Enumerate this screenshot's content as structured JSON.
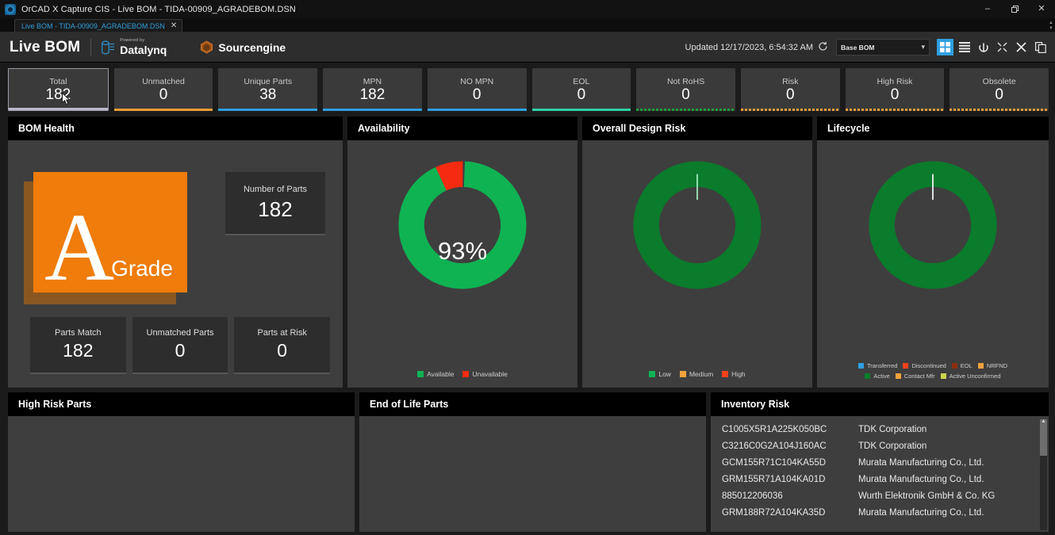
{
  "window": {
    "title": "OrCAD X Capture CIS - Live BOM - TIDA-00909_AGRADEBOM.DSN",
    "minimize_label": "–",
    "restore_label": "❐",
    "close_label": "✕",
    "app_icon": "orcad-app-icon"
  },
  "document_tab": {
    "label": "Live BOM - TIDA-00909_AGRADEBOM.DSN",
    "close_label": "✕"
  },
  "header": {
    "brand": "Live BOM",
    "partners": [
      {
        "pre": "Powered by",
        "name": "Datalynq",
        "tm": "™",
        "icon": "datalynq-logo"
      },
      {
        "pre": "",
        "name": "Sourcengine",
        "tm": "™",
        "icon": "sourcengine-logo"
      }
    ],
    "updated": "Updated 12/17/2023, 6:54:32 AM",
    "refresh_icon": "refresh-icon",
    "bom_select": {
      "value": "Base BOM",
      "caret": "▾"
    },
    "tool_icons": [
      {
        "name": "grid-view-icon",
        "glyph": "grid",
        "active": true
      },
      {
        "name": "list-view-icon",
        "glyph": "list",
        "active": false
      },
      {
        "name": "sync-icon",
        "glyph": "sync",
        "active": false
      },
      {
        "name": "collapse-icon",
        "glyph": "collapse",
        "active": false
      },
      {
        "name": "close-panel-icon",
        "glyph": "x",
        "active": false
      },
      {
        "name": "export-icon",
        "glyph": "export",
        "active": false
      }
    ]
  },
  "kpis": [
    {
      "label": "Total",
      "value": "182",
      "color": "#b9b9c9",
      "dotted": false,
      "selected": true
    },
    {
      "label": "Unmatched",
      "value": "0",
      "color": "#f29b38",
      "dotted": false,
      "selected": false
    },
    {
      "label": "Unique Parts",
      "value": "38",
      "color": "#2f9fe0",
      "dotted": false,
      "selected": false
    },
    {
      "label": "MPN",
      "value": "182",
      "color": "#2f9fe0",
      "dotted": false,
      "selected": false
    },
    {
      "label": "NO MPN",
      "value": "0",
      "color": "#2f9fe0",
      "dotted": false,
      "selected": false
    },
    {
      "label": "EOL",
      "value": "0",
      "color": "#2fd2a8",
      "dotted": false,
      "selected": false
    },
    {
      "label": "Not RoHS",
      "value": "0",
      "color": "#1e9e3e",
      "dotted": true,
      "selected": false
    },
    {
      "label": "Risk",
      "value": "0",
      "color": "#f29b38",
      "dotted": true,
      "selected": false
    },
    {
      "label": "High Risk",
      "value": "0",
      "color": "#f29b38",
      "dotted": true,
      "selected": false
    },
    {
      "label": "Obsolete",
      "value": "0",
      "color": "#f29b38",
      "dotted": true,
      "selected": false
    }
  ],
  "bom_health": {
    "title": "BOM Health",
    "grade_letter": "A",
    "grade_word": "Grade",
    "grade_color": "#ef7c0b",
    "number_of_parts": {
      "label": "Number of Parts",
      "value": "182"
    },
    "stats": [
      {
        "label": "Parts Match",
        "value": "182"
      },
      {
        "label": "Unmatched Parts",
        "value": "0"
      },
      {
        "label": "Parts at Risk",
        "value": "0"
      }
    ]
  },
  "availability": {
    "title": "Availability",
    "center_label": "93%",
    "chart_data": {
      "type": "pie",
      "title": "Availability",
      "categories": [
        "Available",
        "Unavailable"
      ],
      "values": [
        93,
        7
      ],
      "colors": [
        "#0fb352",
        "#f42b10"
      ],
      "legend_position": "bottom",
      "donut": true
    }
  },
  "design_risk": {
    "title": "Overall Design Risk",
    "chart_data": {
      "type": "pie",
      "title": "Overall Design Risk",
      "categories": [
        "Low",
        "Medium",
        "High"
      ],
      "values": [
        100,
        0,
        0
      ],
      "colors": [
        "#0a7c2b",
        "#f2a33c",
        "#f4421c"
      ],
      "legend_position": "bottom",
      "donut": true
    }
  },
  "lifecycle": {
    "title": "Lifecycle",
    "chart_data": {
      "type": "pie",
      "title": "Lifecycle",
      "categories": [
        "Transferred",
        "Discontinued",
        "EOL",
        "NRFND",
        "Active",
        "Contact Mfr",
        "Active Unconfirmed"
      ],
      "values": [
        0,
        0,
        0,
        0,
        100,
        0,
        0
      ],
      "colors": [
        "#2f9fe0",
        "#f4421c",
        "#8c2d10",
        "#f2a33c",
        "#0a7c2b",
        "#f2a33c",
        "#c9d44a"
      ],
      "legend_position": "bottom",
      "donut": true
    }
  },
  "high_risk_parts": {
    "title": "High Risk Parts",
    "rows": []
  },
  "end_of_life_parts": {
    "title": "End of Life Parts",
    "rows": []
  },
  "inventory_risk": {
    "title": "Inventory Risk",
    "rows": [
      {
        "mpn": "C1005X5R1A225K050BC",
        "mfr": "TDK Corporation"
      },
      {
        "mpn": "C3216C0G2A104J160AC",
        "mfr": "TDK Corporation"
      },
      {
        "mpn": "GCM155R71C104KA55D",
        "mfr": "Murata Manufacturing Co., Ltd."
      },
      {
        "mpn": "GRM155R71A104KA01D",
        "mfr": "Murata Manufacturing Co., Ltd."
      },
      {
        "mpn": "885012206036",
        "mfr": "Wurth Elektronik GmbH & Co. KG"
      },
      {
        "mpn": "GRM188R72A104KA35D",
        "mfr": "Murata Manufacturing Co., Ltd."
      }
    ],
    "scroll_up_arrow": "▲"
  }
}
